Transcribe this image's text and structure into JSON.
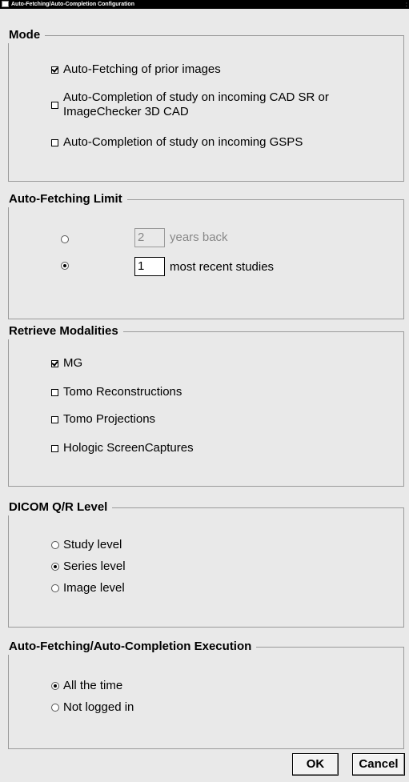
{
  "window": {
    "title": "Auto-Fetching/Auto-Completion Configuration",
    "scroll_mark": ":"
  },
  "mode": {
    "title": "Mode",
    "options": [
      {
        "line1": "Auto-Fetching of prior images",
        "checked": true
      },
      {
        "line1": "Auto-Completion of study on incoming CAD SR or",
        "line2": "ImageChecker 3D CAD",
        "checked": false
      },
      {
        "line1": "Auto-Completion of study on incoming GSPS",
        "checked": false
      }
    ]
  },
  "fetch_limit": {
    "title": "Auto-Fetching Limit",
    "years": {
      "value": "2",
      "label": "years back",
      "selected": false,
      "enabled": false
    },
    "recent": {
      "value": "1",
      "label": "most recent studies",
      "selected": true,
      "enabled": true
    }
  },
  "modalities": {
    "title": "Retrieve Modalities",
    "options": [
      {
        "label": "MG",
        "checked": true
      },
      {
        "label": "Tomo Reconstructions",
        "checked": false
      },
      {
        "label": "Tomo Projections",
        "checked": false
      },
      {
        "label": "Hologic ScreenCaptures",
        "checked": false
      }
    ]
  },
  "qr_level": {
    "title": "DICOM Q/R Level",
    "options": [
      {
        "label": "Study level",
        "selected": false
      },
      {
        "label": "Series level",
        "selected": true
      },
      {
        "label": "Image level",
        "selected": false
      }
    ]
  },
  "execution": {
    "title": "Auto-Fetching/Auto-Completion Execution",
    "options": [
      {
        "label": "All the time",
        "selected": true
      },
      {
        "label": "Not logged in",
        "selected": false
      }
    ]
  },
  "buttons": {
    "ok": "OK",
    "cancel": "Cancel"
  }
}
